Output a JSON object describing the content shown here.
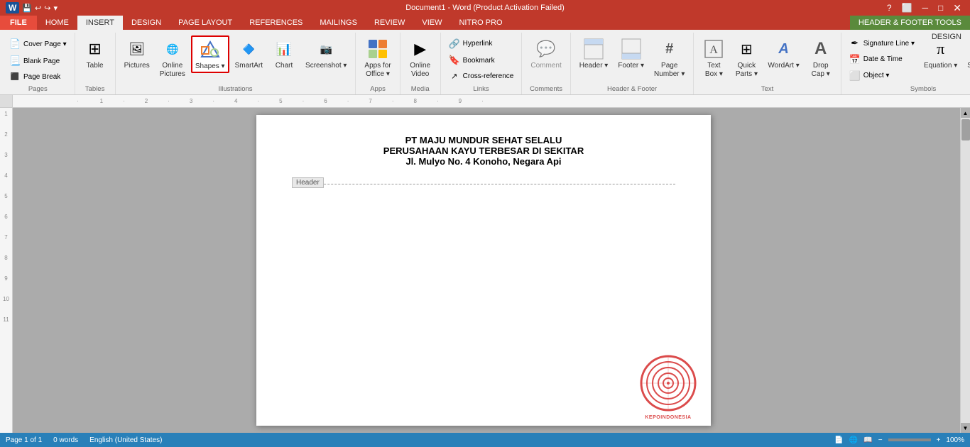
{
  "titleBar": {
    "title": "Document1 - Word (Product Activation Failed)",
    "quickAccess": [
      "💾",
      "↩",
      "↪",
      "▼"
    ]
  },
  "hfToolsBar": {
    "label": "HEADER & FOOTER TOOLS"
  },
  "tabs": [
    {
      "id": "file",
      "label": "FILE",
      "type": "file"
    },
    {
      "id": "home",
      "label": "HOME"
    },
    {
      "id": "insert",
      "label": "INSERT",
      "active": true
    },
    {
      "id": "design",
      "label": "DESIGN"
    },
    {
      "id": "pagelayout",
      "label": "PAGE LAYOUT"
    },
    {
      "id": "references",
      "label": "REFERENCES"
    },
    {
      "id": "mailings",
      "label": "MAILINGS"
    },
    {
      "id": "review",
      "label": "REVIEW"
    },
    {
      "id": "view",
      "label": "VIEW"
    },
    {
      "id": "nitropro",
      "label": "NITRO PRO"
    },
    {
      "id": "hf-design",
      "label": "DESIGN",
      "type": "hf"
    }
  ],
  "ribbon": {
    "groups": [
      {
        "id": "pages",
        "label": "Pages",
        "buttons": [
          {
            "id": "cover-page",
            "icon": "📄",
            "label": "Cover Page ▾",
            "size": "small"
          },
          {
            "id": "blank-page",
            "icon": "📃",
            "label": "Blank Page",
            "size": "small"
          },
          {
            "id": "page-break",
            "icon": "⬛",
            "label": "Page Break",
            "size": "small"
          }
        ]
      },
      {
        "id": "tables",
        "label": "Tables",
        "buttons": [
          {
            "id": "table",
            "icon": "⊞",
            "label": "Table",
            "size": "large"
          }
        ]
      },
      {
        "id": "illustrations",
        "label": "Illustrations",
        "buttons": [
          {
            "id": "pictures",
            "icon": "🖼",
            "label": "Pictures",
            "size": "large"
          },
          {
            "id": "online-pictures",
            "icon": "🌐",
            "label": "Online Pictures",
            "size": "large"
          },
          {
            "id": "shapes",
            "icon": "△",
            "label": "Shapes ▾",
            "size": "large",
            "highlighted": true
          },
          {
            "id": "smartart",
            "icon": "🔷",
            "label": "SmartArt",
            "size": "large"
          },
          {
            "id": "chart",
            "icon": "📊",
            "label": "Chart",
            "size": "large"
          },
          {
            "id": "screenshot",
            "icon": "📷",
            "label": "Screenshot ▾",
            "size": "large"
          }
        ]
      },
      {
        "id": "apps",
        "label": "Apps",
        "buttons": [
          {
            "id": "apps-for-office",
            "icon": "🔲",
            "label": "Apps for Office ▾",
            "size": "large"
          }
        ]
      },
      {
        "id": "media",
        "label": "Media",
        "buttons": [
          {
            "id": "online-video",
            "icon": "▶",
            "label": "Online Video",
            "size": "large"
          }
        ]
      },
      {
        "id": "links",
        "label": "Links",
        "buttons": [
          {
            "id": "hyperlink",
            "icon": "🔗",
            "label": "Hyperlink",
            "size": "small"
          },
          {
            "id": "bookmark",
            "icon": "🔖",
            "label": "Bookmark",
            "size": "small"
          },
          {
            "id": "cross-reference",
            "icon": "↗",
            "label": "Cross-reference",
            "size": "small"
          }
        ]
      },
      {
        "id": "comments",
        "label": "Comments",
        "buttons": [
          {
            "id": "comment",
            "icon": "💬",
            "label": "Comment",
            "size": "large"
          }
        ]
      },
      {
        "id": "header-footer",
        "label": "Header & Footer",
        "buttons": [
          {
            "id": "header",
            "icon": "▭",
            "label": "Header ▾",
            "size": "large"
          },
          {
            "id": "footer",
            "icon": "▭",
            "label": "Footer ▾",
            "size": "large"
          },
          {
            "id": "page-number",
            "icon": "#",
            "label": "Page Number ▾",
            "size": "large"
          }
        ]
      },
      {
        "id": "text",
        "label": "Text",
        "buttons": [
          {
            "id": "text-box",
            "icon": "A",
            "label": "Text Box ▾",
            "size": "large"
          },
          {
            "id": "quick-parts",
            "icon": "⊞",
            "label": "Quick Parts ▾",
            "size": "large"
          },
          {
            "id": "wordart",
            "icon": "A",
            "label": "WordArt ▾",
            "size": "large"
          },
          {
            "id": "drop-cap",
            "icon": "A",
            "label": "Drop Cap ▾",
            "size": "large"
          }
        ]
      },
      {
        "id": "symbols",
        "label": "Symbols",
        "buttons": [
          {
            "id": "signature-line",
            "icon": "✒",
            "label": "Signature Line ▾",
            "size": "small"
          },
          {
            "id": "date-time",
            "icon": "📅",
            "label": "Date & Time",
            "size": "small"
          },
          {
            "id": "object",
            "icon": "⊞",
            "label": "Object ▾",
            "size": "small"
          },
          {
            "id": "equation",
            "icon": "π",
            "label": "Equation ▾",
            "size": "large"
          },
          {
            "id": "symbol",
            "icon": "Ω",
            "label": "Symbol ▾",
            "size": "large"
          }
        ]
      }
    ]
  },
  "document": {
    "line1": "PT MAJU MUNDUR SEHAT SELALU",
    "line2": "PERUSAHAAN KAYU TERBESAR DI SEKITAR",
    "line3": "Jl. Mulyo No. 4 Konoho, Negara Api",
    "headerLabel": "Header"
  },
  "statusBar": {
    "page": "Page 1 of 1",
    "words": "0 words",
    "language": "English (United States)"
  }
}
